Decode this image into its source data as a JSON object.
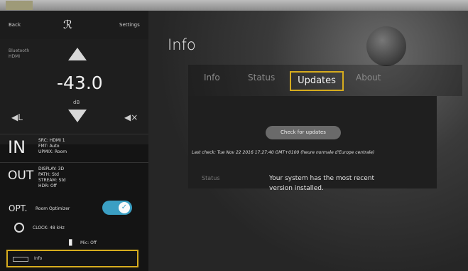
{
  "sidebar": {
    "header": {
      "left_label": "Back",
      "logo": "ℛ",
      "right_label": "Settings"
    },
    "source_text": "Bluetooth\nHDMI",
    "volume": {
      "value": "-43.0",
      "unit": "dB"
    },
    "speaker_left": "◀L",
    "speaker_right": "◀×",
    "input": {
      "label": "IN",
      "lines": [
        "SRC: HDMI 1",
        "FMT: Auto",
        "UPMIX: Room"
      ]
    },
    "output": {
      "label": "OUT",
      "lines": [
        "DISPLAY: 3D",
        "PATH: Std",
        "STREAM: Std",
        "HDR: Off"
      ]
    },
    "optimizer": {
      "label": "OPT.",
      "sub": "Room Optimizer",
      "enabled": true
    },
    "clock": {
      "text": "CLOCK: 48 kHz"
    },
    "mic": {
      "text": "Mic: Off"
    },
    "info_button": {
      "label": "Info"
    }
  },
  "main": {
    "title": "Info",
    "tabs": [
      {
        "label": "Info"
      },
      {
        "label": "Status"
      },
      {
        "label": "Updates",
        "active": true
      },
      {
        "label": "About"
      }
    ],
    "updates": {
      "check_button": "Check for updates",
      "last_check": "Last check: Tue Nov 22 2016 17:27:40 GMT+0100 (heure normale d'Europe centrale)",
      "status_label": "Status",
      "status_message": "Your system has the most recent version installed."
    }
  },
  "colors": {
    "highlight": "#d6ac1e",
    "toggle_on": "#3b9fc3"
  }
}
